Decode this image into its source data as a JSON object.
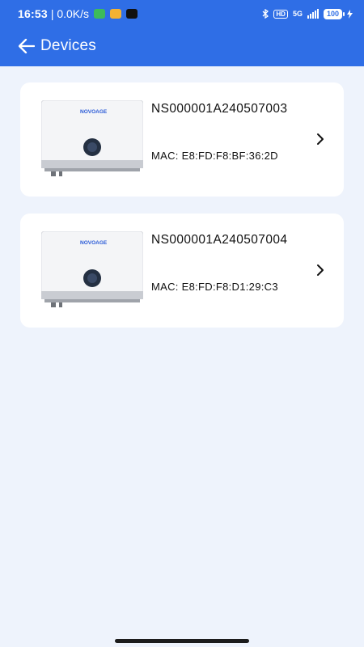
{
  "status_bar": {
    "time": "16:53",
    "speed": "| 0.0K/s",
    "network": "5G",
    "hd": "HD",
    "battery": "100",
    "app_icons": [
      "message-app-icon",
      "notes-app-icon",
      "tiktok-app-icon"
    ]
  },
  "header": {
    "title": "Devices",
    "back_icon": "arrow-left-icon",
    "bg_color": "#2f6ee6"
  },
  "devices": [
    {
      "serial": "NS000001A240507003",
      "mac_label": "MAC: E8:FD:F8:BF:36:2D",
      "brand": "NOVOAGE"
    },
    {
      "serial": "NS000001A240507004",
      "mac_label": "MAC: E8:FD:F8:D1:29:C3",
      "brand": "NOVOAGE"
    }
  ]
}
